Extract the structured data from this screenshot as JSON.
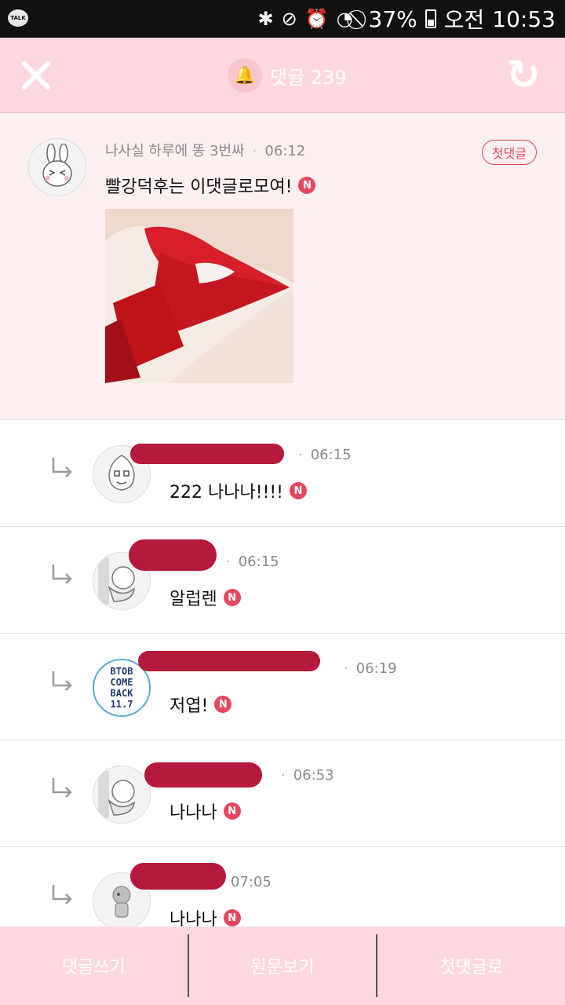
{
  "status_bar": {
    "app_icon_label": "TALK",
    "battery": "37%",
    "ampm": "오전",
    "time": "10:53",
    "icons": [
      "bluetooth-icon",
      "vibrate-mute-icon",
      "alarm-icon",
      "wifi-icon",
      "blocked-icon",
      "battery-icon"
    ]
  },
  "header": {
    "title": "댓글 239",
    "close_icon": "close-icon",
    "refresh_icon": "refresh-icon",
    "bell_icon": "bell-icon"
  },
  "main_comment": {
    "author": "나사실 하루에 똥 3번싸",
    "time": "06:12",
    "badge": "첫댓글",
    "text": "빨강덕후는 이댓글로모여!",
    "new_badge": "N"
  },
  "replies": [
    {
      "time": "06:15",
      "text": "222 나나나!!!!",
      "new_badge": "N"
    },
    {
      "time": "06:15",
      "text": "알럽렌",
      "new_badge": "N"
    },
    {
      "time": "06:19",
      "text": "저엽!",
      "new_badge": "N",
      "avatar_text": "BTOB COME BACK 11.7"
    },
    {
      "time": "06:53",
      "text": "나나나",
      "new_badge": "N"
    },
    {
      "time": "07:05",
      "text": "나나나",
      "new_badge": "N"
    }
  ],
  "bottom_bar": {
    "write_label": "댓글쓰기",
    "view_original_label": "원문보기",
    "first_comment_label": "첫댓글로"
  },
  "colors": {
    "header_bg": "#fdd9df",
    "main_comment_bg": "#fdf0f1",
    "accent": "#e5485e",
    "redaction": "#b5193b"
  }
}
